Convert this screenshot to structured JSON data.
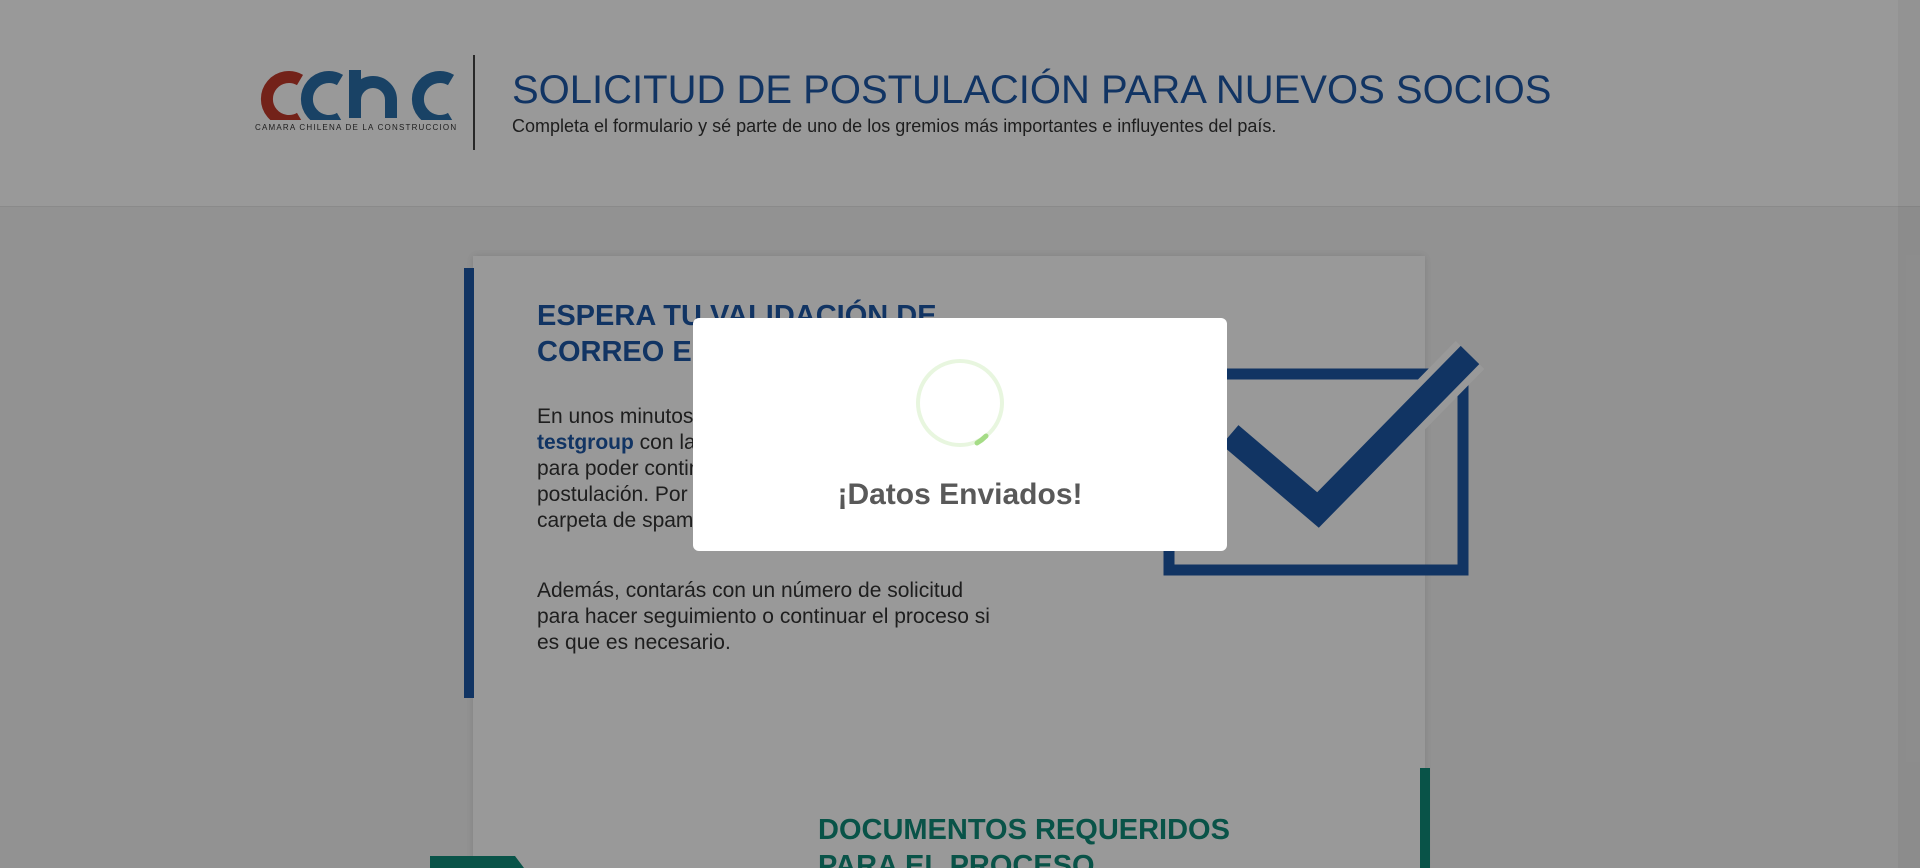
{
  "header": {
    "logo_text": "cchc",
    "logo_subtext": "CAMARA CHILENA DE LA CONSTRUCCION",
    "title": "SOLICITUD DE POSTULACIÓN PARA NUEVOS SOCIOS",
    "subtitle": "Completa el formulario y sé parte de uno de los gremios más importantes e influyentes del país."
  },
  "validation_section": {
    "title_line1": "ESPERA TU VALIDACIÓN DE",
    "title_line2": "CORREO ELECTRÓNICO",
    "para1_before": "En unos minutos recibirás un correo en tu casilla ",
    "para1_email": "testgroup",
    "para1_after": " con las instrucciones de validación para poder continuar con el proceso de postulación. Por favor revise también en la carpeta de spam.",
    "para2": "Además, contarás con un número de solicitud para hacer seguimiento o continuar el proceso si es que es necesario."
  },
  "documents_section": {
    "title_line1": "DOCUMENTOS REQUERIDOS",
    "title_line2": "PARA EL PROCESO"
  },
  "modal": {
    "title": "¡Datos Enviados!"
  },
  "colors": {
    "primary_blue": "#1d57a6",
    "teal": "#0f8a78",
    "logo_red": "#c0392b",
    "logo_blue": "#2a6fa8",
    "spinner_green": "#a5dc86"
  }
}
